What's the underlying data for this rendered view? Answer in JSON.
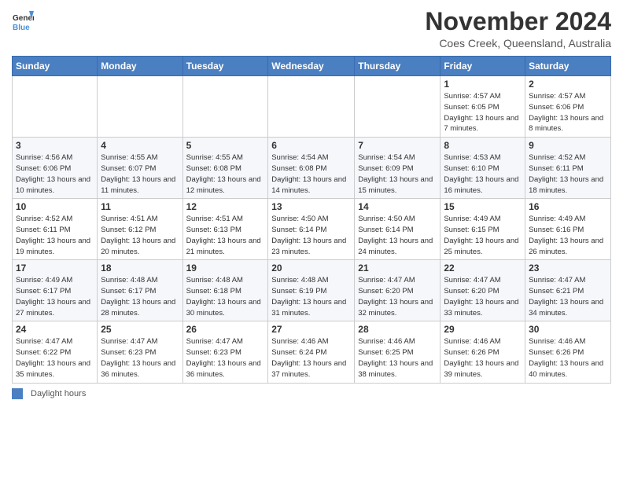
{
  "logo": {
    "text_general": "General",
    "text_blue": "Blue"
  },
  "title": "November 2024",
  "location": "Coes Creek, Queensland, Australia",
  "days_of_week": [
    "Sunday",
    "Monday",
    "Tuesday",
    "Wednesday",
    "Thursday",
    "Friday",
    "Saturday"
  ],
  "footer_label": "Daylight hours",
  "weeks": [
    [
      {
        "day": "",
        "sunrise": "",
        "sunset": "",
        "daylight": ""
      },
      {
        "day": "",
        "sunrise": "",
        "sunset": "",
        "daylight": ""
      },
      {
        "day": "",
        "sunrise": "",
        "sunset": "",
        "daylight": ""
      },
      {
        "day": "",
        "sunrise": "",
        "sunset": "",
        "daylight": ""
      },
      {
        "day": "",
        "sunrise": "",
        "sunset": "",
        "daylight": ""
      },
      {
        "day": "1",
        "sunrise": "Sunrise: 4:57 AM",
        "sunset": "Sunset: 6:05 PM",
        "daylight": "Daylight: 13 hours and 7 minutes."
      },
      {
        "day": "2",
        "sunrise": "Sunrise: 4:57 AM",
        "sunset": "Sunset: 6:06 PM",
        "daylight": "Daylight: 13 hours and 8 minutes."
      }
    ],
    [
      {
        "day": "3",
        "sunrise": "Sunrise: 4:56 AM",
        "sunset": "Sunset: 6:06 PM",
        "daylight": "Daylight: 13 hours and 10 minutes."
      },
      {
        "day": "4",
        "sunrise": "Sunrise: 4:55 AM",
        "sunset": "Sunset: 6:07 PM",
        "daylight": "Daylight: 13 hours and 11 minutes."
      },
      {
        "day": "5",
        "sunrise": "Sunrise: 4:55 AM",
        "sunset": "Sunset: 6:08 PM",
        "daylight": "Daylight: 13 hours and 12 minutes."
      },
      {
        "day": "6",
        "sunrise": "Sunrise: 4:54 AM",
        "sunset": "Sunset: 6:08 PM",
        "daylight": "Daylight: 13 hours and 14 minutes."
      },
      {
        "day": "7",
        "sunrise": "Sunrise: 4:54 AM",
        "sunset": "Sunset: 6:09 PM",
        "daylight": "Daylight: 13 hours and 15 minutes."
      },
      {
        "day": "8",
        "sunrise": "Sunrise: 4:53 AM",
        "sunset": "Sunset: 6:10 PM",
        "daylight": "Daylight: 13 hours and 16 minutes."
      },
      {
        "day": "9",
        "sunrise": "Sunrise: 4:52 AM",
        "sunset": "Sunset: 6:11 PM",
        "daylight": "Daylight: 13 hours and 18 minutes."
      }
    ],
    [
      {
        "day": "10",
        "sunrise": "Sunrise: 4:52 AM",
        "sunset": "Sunset: 6:11 PM",
        "daylight": "Daylight: 13 hours and 19 minutes."
      },
      {
        "day": "11",
        "sunrise": "Sunrise: 4:51 AM",
        "sunset": "Sunset: 6:12 PM",
        "daylight": "Daylight: 13 hours and 20 minutes."
      },
      {
        "day": "12",
        "sunrise": "Sunrise: 4:51 AM",
        "sunset": "Sunset: 6:13 PM",
        "daylight": "Daylight: 13 hours and 21 minutes."
      },
      {
        "day": "13",
        "sunrise": "Sunrise: 4:50 AM",
        "sunset": "Sunset: 6:14 PM",
        "daylight": "Daylight: 13 hours and 23 minutes."
      },
      {
        "day": "14",
        "sunrise": "Sunrise: 4:50 AM",
        "sunset": "Sunset: 6:14 PM",
        "daylight": "Daylight: 13 hours and 24 minutes."
      },
      {
        "day": "15",
        "sunrise": "Sunrise: 4:49 AM",
        "sunset": "Sunset: 6:15 PM",
        "daylight": "Daylight: 13 hours and 25 minutes."
      },
      {
        "day": "16",
        "sunrise": "Sunrise: 4:49 AM",
        "sunset": "Sunset: 6:16 PM",
        "daylight": "Daylight: 13 hours and 26 minutes."
      }
    ],
    [
      {
        "day": "17",
        "sunrise": "Sunrise: 4:49 AM",
        "sunset": "Sunset: 6:17 PM",
        "daylight": "Daylight: 13 hours and 27 minutes."
      },
      {
        "day": "18",
        "sunrise": "Sunrise: 4:48 AM",
        "sunset": "Sunset: 6:17 PM",
        "daylight": "Daylight: 13 hours and 28 minutes."
      },
      {
        "day": "19",
        "sunrise": "Sunrise: 4:48 AM",
        "sunset": "Sunset: 6:18 PM",
        "daylight": "Daylight: 13 hours and 30 minutes."
      },
      {
        "day": "20",
        "sunrise": "Sunrise: 4:48 AM",
        "sunset": "Sunset: 6:19 PM",
        "daylight": "Daylight: 13 hours and 31 minutes."
      },
      {
        "day": "21",
        "sunrise": "Sunrise: 4:47 AM",
        "sunset": "Sunset: 6:20 PM",
        "daylight": "Daylight: 13 hours and 32 minutes."
      },
      {
        "day": "22",
        "sunrise": "Sunrise: 4:47 AM",
        "sunset": "Sunset: 6:20 PM",
        "daylight": "Daylight: 13 hours and 33 minutes."
      },
      {
        "day": "23",
        "sunrise": "Sunrise: 4:47 AM",
        "sunset": "Sunset: 6:21 PM",
        "daylight": "Daylight: 13 hours and 34 minutes."
      }
    ],
    [
      {
        "day": "24",
        "sunrise": "Sunrise: 4:47 AM",
        "sunset": "Sunset: 6:22 PM",
        "daylight": "Daylight: 13 hours and 35 minutes."
      },
      {
        "day": "25",
        "sunrise": "Sunrise: 4:47 AM",
        "sunset": "Sunset: 6:23 PM",
        "daylight": "Daylight: 13 hours and 36 minutes."
      },
      {
        "day": "26",
        "sunrise": "Sunrise: 4:47 AM",
        "sunset": "Sunset: 6:23 PM",
        "daylight": "Daylight: 13 hours and 36 minutes."
      },
      {
        "day": "27",
        "sunrise": "Sunrise: 4:46 AM",
        "sunset": "Sunset: 6:24 PM",
        "daylight": "Daylight: 13 hours and 37 minutes."
      },
      {
        "day": "28",
        "sunrise": "Sunrise: 4:46 AM",
        "sunset": "Sunset: 6:25 PM",
        "daylight": "Daylight: 13 hours and 38 minutes."
      },
      {
        "day": "29",
        "sunrise": "Sunrise: 4:46 AM",
        "sunset": "Sunset: 6:26 PM",
        "daylight": "Daylight: 13 hours and 39 minutes."
      },
      {
        "day": "30",
        "sunrise": "Sunrise: 4:46 AM",
        "sunset": "Sunset: 6:26 PM",
        "daylight": "Daylight: 13 hours and 40 minutes."
      }
    ]
  ]
}
